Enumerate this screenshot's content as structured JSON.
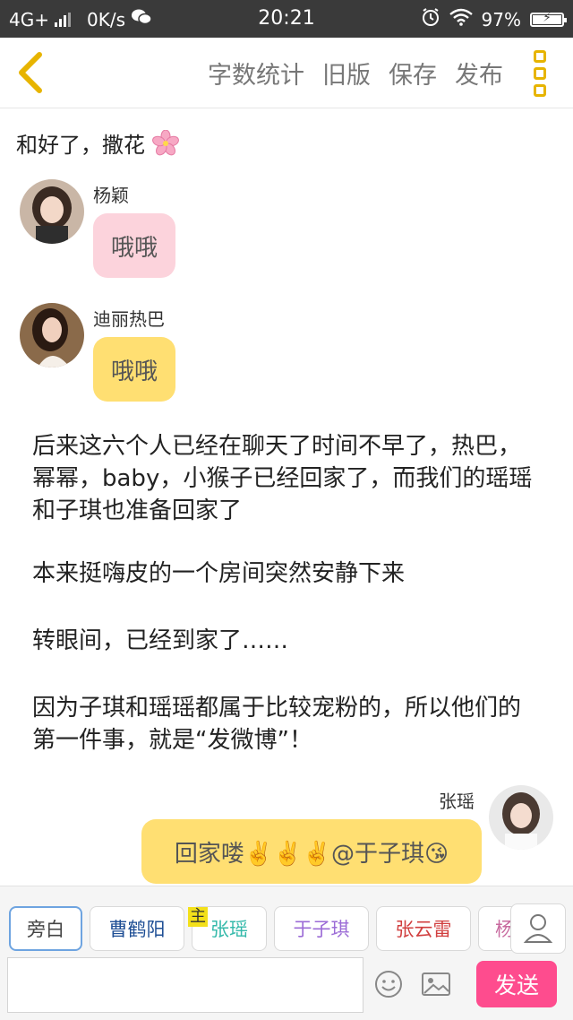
{
  "status_bar": {
    "network": "4G+",
    "speed": "0K/s",
    "time": "20:21",
    "battery": "97%"
  },
  "toolbar": {
    "word_count": "字数统计",
    "old_version": "旧版",
    "save": "保存",
    "publish": "发布"
  },
  "title": "和好了，撒花",
  "messages": [
    {
      "name": "杨颖",
      "text": "哦哦",
      "bubble_color": "#fcd3dc"
    },
    {
      "name": "迪丽热巴",
      "text": "哦哦",
      "bubble_color": "#ffdf72"
    }
  ],
  "narration": [
    "后来这六个人已经在聊天了时间不早了，热巴，幂幂，baby，小猴子已经回家了，而我们的瑶瑶和子琪也准备回家了",
    "本来挺嗨皮的一个房间突然安静下来",
    "转眼间，已经到家了……",
    "因为子琪和瑶瑶都属于比较宠粉的，所以他们的第一件事，就是“发微博”！"
  ],
  "right_message": {
    "name": "张瑶",
    "text": "回家喽✌️✌️✌️@于子琪😘",
    "bubble_color": "#ffdf72"
  },
  "roles": {
    "items": [
      {
        "label": "旁白",
        "color": "#444444"
      },
      {
        "label": "曹鹤阳",
        "color": "#1f4f95"
      },
      {
        "label": "张瑶",
        "color": "#34b9aa"
      },
      {
        "label": "于子琪",
        "color": "#9b6bd6"
      },
      {
        "label": "张云雷",
        "color": "#d13f3f"
      },
      {
        "label": "杨",
        "color": "#c86a9f"
      }
    ],
    "main_mark": "主"
  },
  "input": {
    "placeholder": "",
    "send_label": "发送"
  },
  "colors": {
    "accent": "#e7b400",
    "send": "#fe4c8e"
  }
}
